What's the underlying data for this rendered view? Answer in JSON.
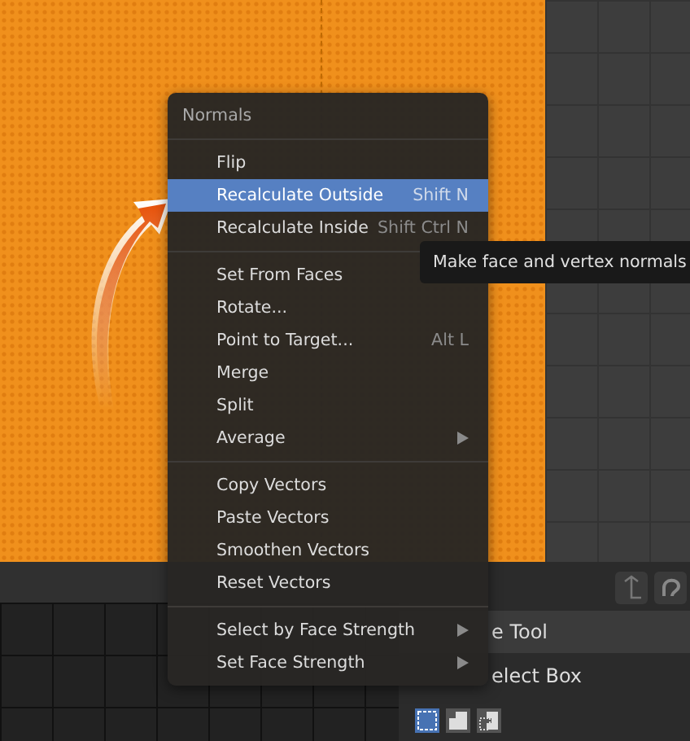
{
  "menu": {
    "title": "Normals",
    "sections": [
      {
        "items": [
          {
            "label": "Flip",
            "submenu": false,
            "selected": false
          },
          {
            "label": "Recalculate Outside",
            "shortcut": "Shift N",
            "submenu": false,
            "selected": true
          },
          {
            "label": "Recalculate Inside",
            "shortcut": "Shift Ctrl N",
            "submenu": false,
            "selected": false
          }
        ]
      },
      {
        "items": [
          {
            "label": "Set From Faces",
            "submenu": false,
            "selected": false
          },
          {
            "label": "Rotate...",
            "submenu": false,
            "selected": false
          },
          {
            "label": "Point to Target...",
            "shortcut": "Alt L",
            "submenu": false,
            "selected": false
          },
          {
            "label": "Merge",
            "submenu": false,
            "selected": false
          },
          {
            "label": "Split",
            "submenu": false,
            "selected": false
          },
          {
            "label": "Average",
            "submenu": true,
            "selected": false
          }
        ]
      },
      {
        "items": [
          {
            "label": "Copy Vectors",
            "submenu": false,
            "selected": false
          },
          {
            "label": "Paste Vectors",
            "submenu": false,
            "selected": false
          },
          {
            "label": "Smoothen Vectors",
            "submenu": false,
            "selected": false
          },
          {
            "label": "Reset Vectors",
            "submenu": false,
            "selected": false
          }
        ]
      },
      {
        "items": [
          {
            "label": "Select by Face Strength",
            "submenu": true,
            "selected": false
          },
          {
            "label": "Set Face Strength",
            "submenu": true,
            "selected": false
          }
        ]
      }
    ]
  },
  "tooltip": "Make face and vertex normals",
  "tool_panel": {
    "header": "e Tool",
    "tool": "elect Box"
  }
}
